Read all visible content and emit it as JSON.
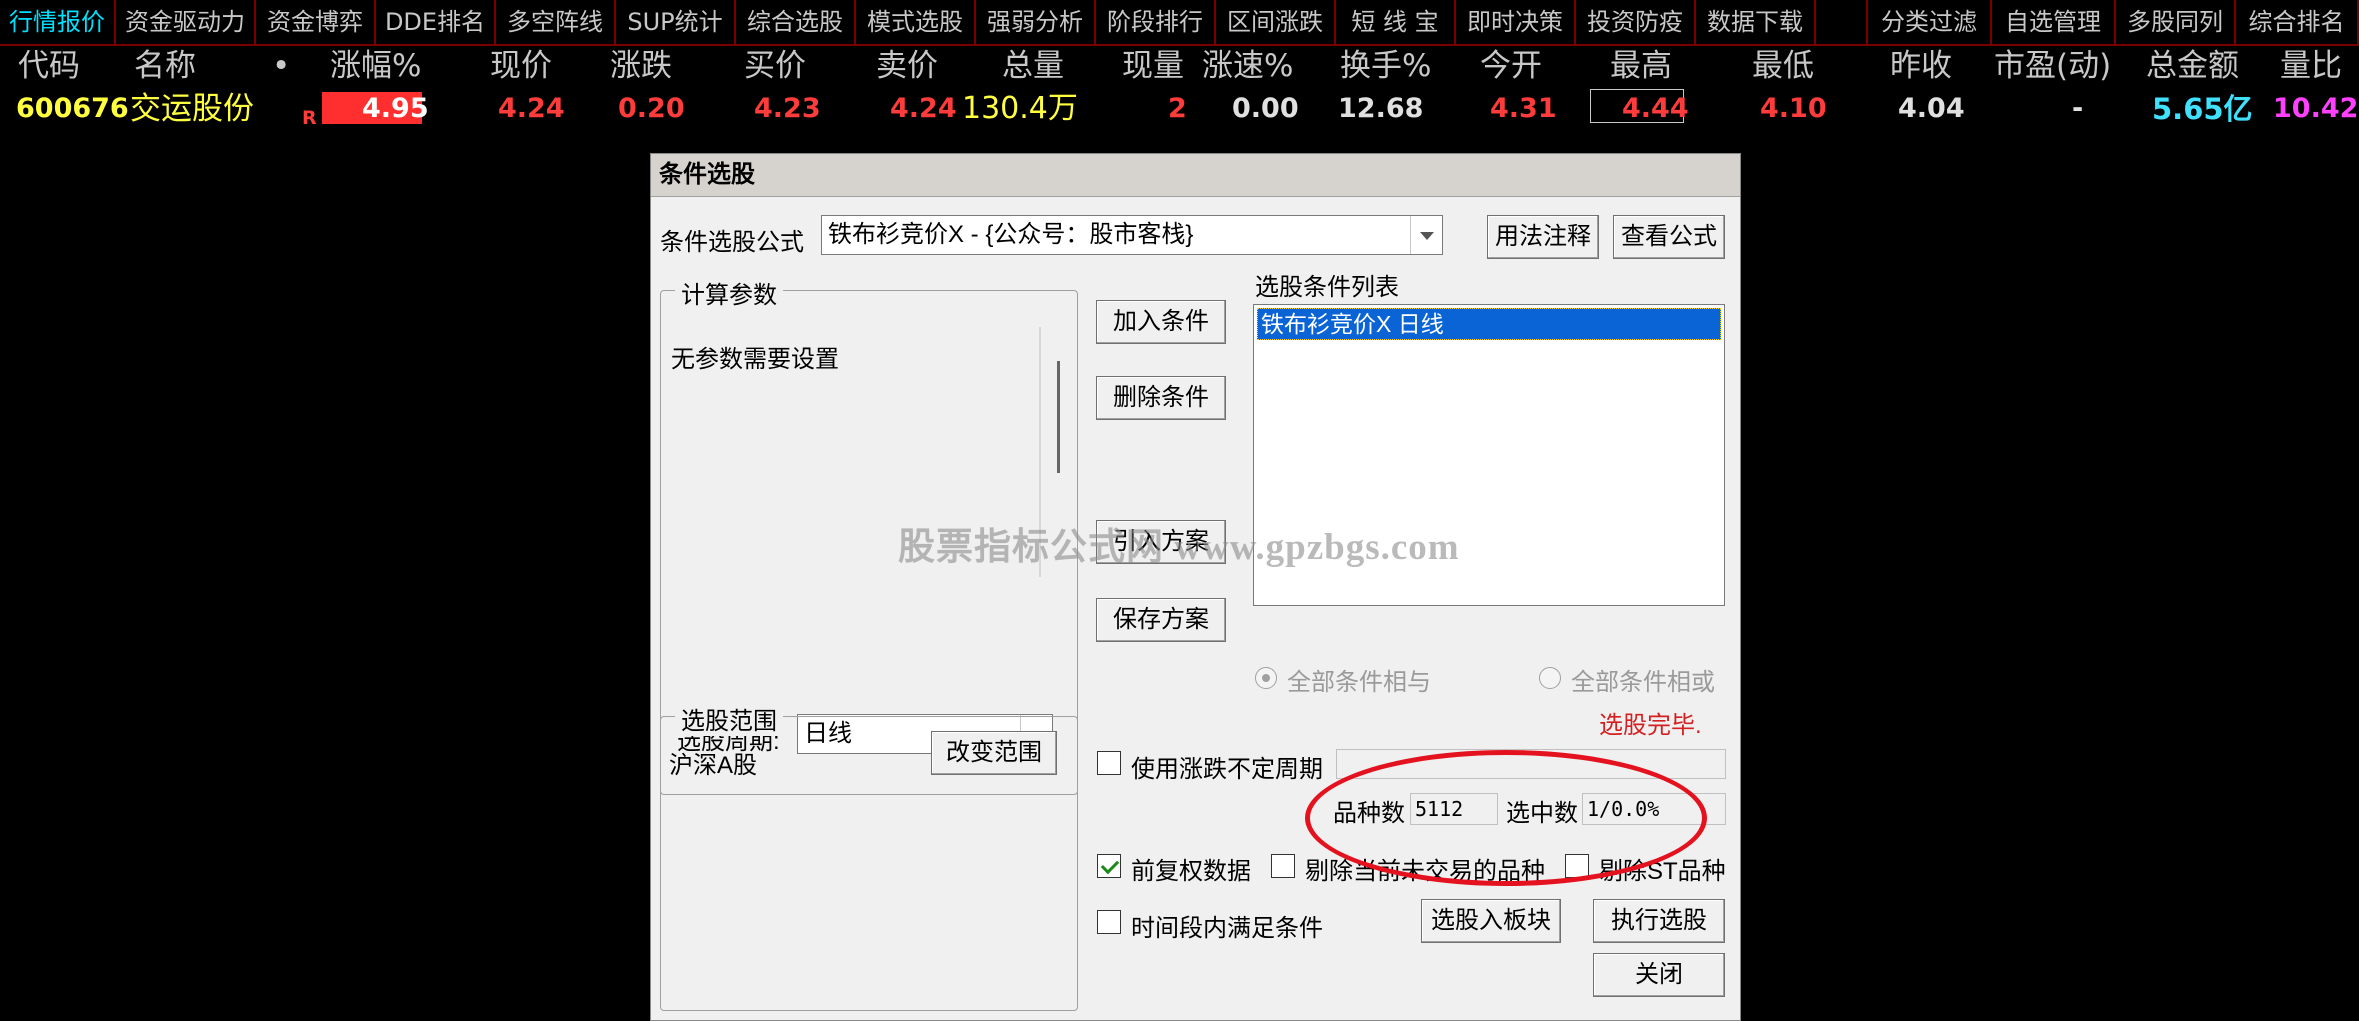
{
  "menu": {
    "items": [
      {
        "label": "行情报价"
      },
      {
        "label": "资金驱动力"
      },
      {
        "label": "资金博弈"
      },
      {
        "label": "DDE排名"
      },
      {
        "label": "多空阵线"
      },
      {
        "label": "SUP统计"
      },
      {
        "label": "综合选股"
      },
      {
        "label": "模式选股"
      },
      {
        "label": "强弱分析"
      },
      {
        "label": "阶段排行"
      },
      {
        "label": "区间涨跌"
      },
      {
        "label": "短 线 宝"
      },
      {
        "label": "即时决策"
      },
      {
        "label": "投资防疫"
      },
      {
        "label": "数据下载"
      },
      {
        "label": "分类过滤"
      },
      {
        "label": "自选管理"
      },
      {
        "label": "多股同列"
      },
      {
        "label": "综合排名"
      }
    ]
  },
  "quote": {
    "columns": [
      "代码",
      "名称",
      "•",
      "涨幅%",
      "现价",
      "涨跌",
      "买价",
      "卖价",
      "总量",
      "现量",
      "涨速%",
      "换手%",
      "今开",
      "最高",
      "最低",
      "昨收",
      "市盈(动)",
      "总金额",
      "量比"
    ],
    "row": {
      "code": "600676",
      "name": "交运股份",
      "flag": "R",
      "change_pct": "4.95",
      "price": "4.24",
      "change": "0.20",
      "bid": "4.23",
      "ask": "4.24",
      "volume": "130.4万",
      "current_volume": "2",
      "speed": "0.00",
      "turnover": "12.68",
      "open": "4.31",
      "high": "4.44",
      "low": "4.10",
      "prev_close": "4.04",
      "pe": "-",
      "amount": "5.65亿",
      "vol_ratio": "10.42"
    },
    "colors": {
      "up": "#ff3c3c",
      "neutral": "#e0e0e0",
      "yellow": "#ffff40",
      "cyan": "#40e0ff",
      "magenta": "#ff40ff",
      "header": "#c8c8c8"
    }
  },
  "dialog": {
    "title": "条件选股",
    "formula_label": "条件选股公式",
    "formula_value": "铁布衫竞价X  - {公众号：股市客栈}",
    "usage_button": "用法注释",
    "view_formula_button": "查看公式",
    "calc_params_legend": "计算参数",
    "no_params_text": "无参数需要设置",
    "period_label": "选股周期:",
    "period_value": "日线",
    "scope_legend": "选股范围",
    "scope_value": "沪深A股",
    "change_scope_button": "改变范围",
    "add_condition_button": "加入条件",
    "delete_condition_button": "删除条件",
    "import_plan_button": "引入方案",
    "save_plan_button": "保存方案",
    "condition_list_label": "选股条件列表",
    "condition_list": [
      {
        "text": "铁布衫竞价X   日线"
      }
    ],
    "radio_and": "全部条件相与",
    "radio_or": "全部条件相或",
    "status": "选股完毕.",
    "use_variable_period": "使用涨跌不定周期",
    "variety_count_label": "品种数",
    "variety_count_value": "5112",
    "selected_count_label": "选中数",
    "selected_count_value": "1/0.0%",
    "forward_adjust": "前复权数据",
    "exclude_untraded": "剔除当前未交易的品种",
    "exclude_st": "剔除ST品种",
    "time_range_condition": "时间段内满足条件",
    "to_block_button": "选股入板块",
    "execute_button": "执行选股",
    "close_button": "关闭"
  },
  "watermark": "股票指标公式网 www.gpzbgs.com"
}
